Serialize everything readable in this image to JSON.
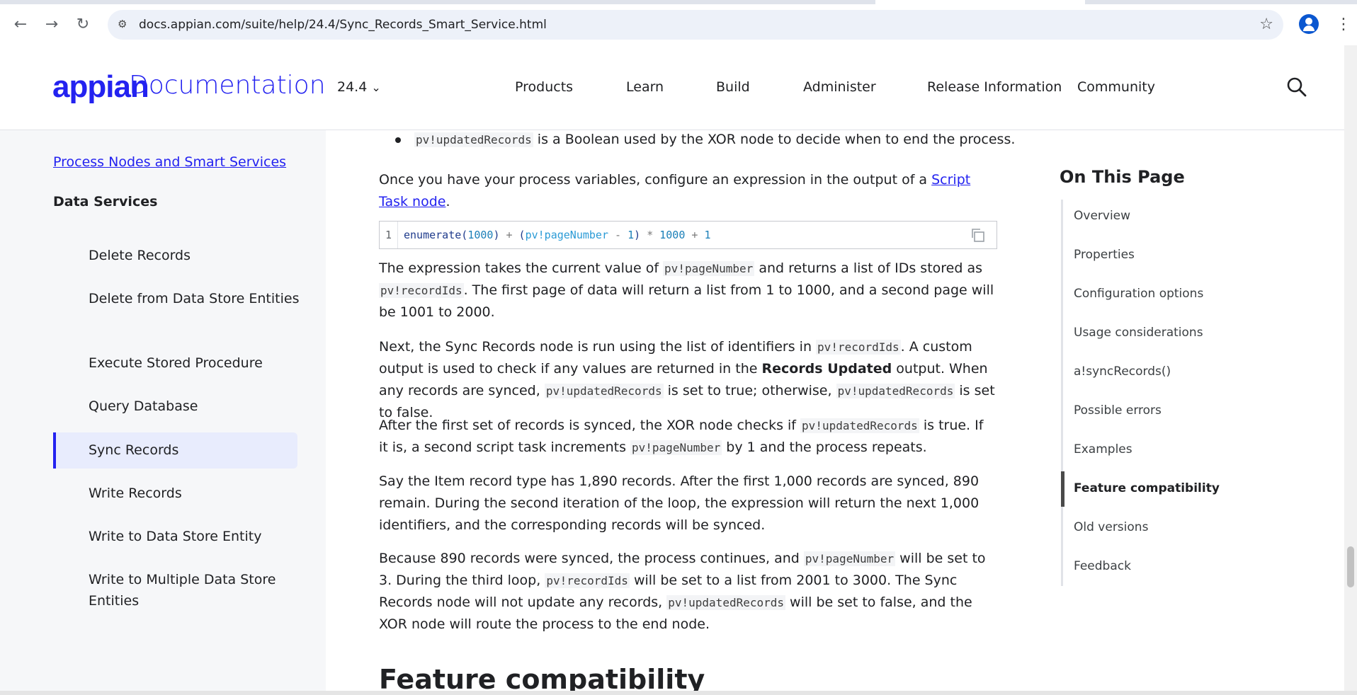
{
  "browser": {
    "url": "docs.appian.com/suite/help/24.4/Sync_Records_Smart_Service.html",
    "back_glyph": "←",
    "forward_glyph": "→",
    "reload_glyph": "↻",
    "tune_glyph": "⚙",
    "star_glyph": "☆",
    "menu_glyph": "⋮"
  },
  "header": {
    "logo_brand": "appian",
    "logo_text": "Documentation",
    "version": "24.4",
    "version_caret": "⌄",
    "nav": [
      "Products",
      "Learn",
      "Build",
      "Administer",
      "Release Information",
      "Community"
    ]
  },
  "sidebar": {
    "parent_link": "Process Nodes and Smart Services",
    "section": "Data Services",
    "items": [
      "Delete Records",
      "Delete from Data Store Entities",
      "Execute Stored Procedure",
      "Query Database",
      "Sync Records",
      "Write Records",
      "Write to Data Store Entity",
      "Write to Multiple Data Store Entities"
    ],
    "active_item": "Sync Records"
  },
  "content": {
    "bullet_code": "pv!updatedRecords",
    "bullet_text": " is a Boolean used by the XOR node to decide when to end the process.",
    "p1_a": "Once you have your process variables, configure an expression in the output of a ",
    "p1_link": "Script Task node",
    "p1_b": ".",
    "code_line_number": "1",
    "code_line": "enumerate(1000) + (pv!pageNumber - 1) * 1000 + 1",
    "p2": {
      "t1": "The expression takes the current value of ",
      "c1": "pv!pageNumber",
      "t2": " and returns a list of IDs stored as ",
      "c2": "pv!recordIds",
      "t3": ". The first page of data will return a list from 1 to 1000, and a second page will be 1001 to 2000."
    },
    "p3": {
      "t1": "Next, the Sync Records node is run using the list of identifiers in ",
      "c1": "pv!recordIds",
      "t2": ". A custom output is used to check if any values are returned in the ",
      "b1": "Records Updated",
      "t3": " output. When any records are synced, ",
      "c2": "pv!updatedRecords",
      "t4": " is set to true; otherwise, ",
      "c3": "pv!updatedRecords",
      "t5": " is set to false."
    },
    "p4": {
      "t1": "After the first set of records is synced, the XOR node checks if ",
      "c1": "pv!updatedRecords",
      "t2": " is true. If it is, a second script task increments ",
      "c2": "pv!pageNumber",
      "t3": " by 1 and the process repeats."
    },
    "p5": "Say the Item record type has 1,890 records. After the first 1,000 records are synced, 890 remain. During the second iteration of the loop, the expression will return the next 1,000 identifiers, and the corresponding records will be synced.",
    "p6": {
      "t1": "Because 890 records were synced, the process continues, and ",
      "c1": "pv!pageNumber",
      "t2": " will be set to 3. During the third loop, ",
      "c2": "pv!recordIds",
      "t3": " will be set to a list from 2001 to 3000. The Sync Records node will not update any records, ",
      "c3": "pv!updatedRecords",
      "t4": " will be set to false, and the XOR node will route the process to the end node."
    },
    "h2": "Feature compatibility"
  },
  "toc": {
    "title": "On This Page",
    "items": [
      "Overview",
      "Properties",
      "Configuration options",
      "Usage considerations",
      "a!syncRecords()",
      "Possible errors",
      "Examples",
      "Feature compatibility",
      "Old versions",
      "Feedback"
    ],
    "active_item": "Feature compatibility"
  },
  "colors": {
    "brand": "#2322f0",
    "active_bg": "#e8ecfd",
    "sidebar_bg": "#f6f7f9"
  }
}
